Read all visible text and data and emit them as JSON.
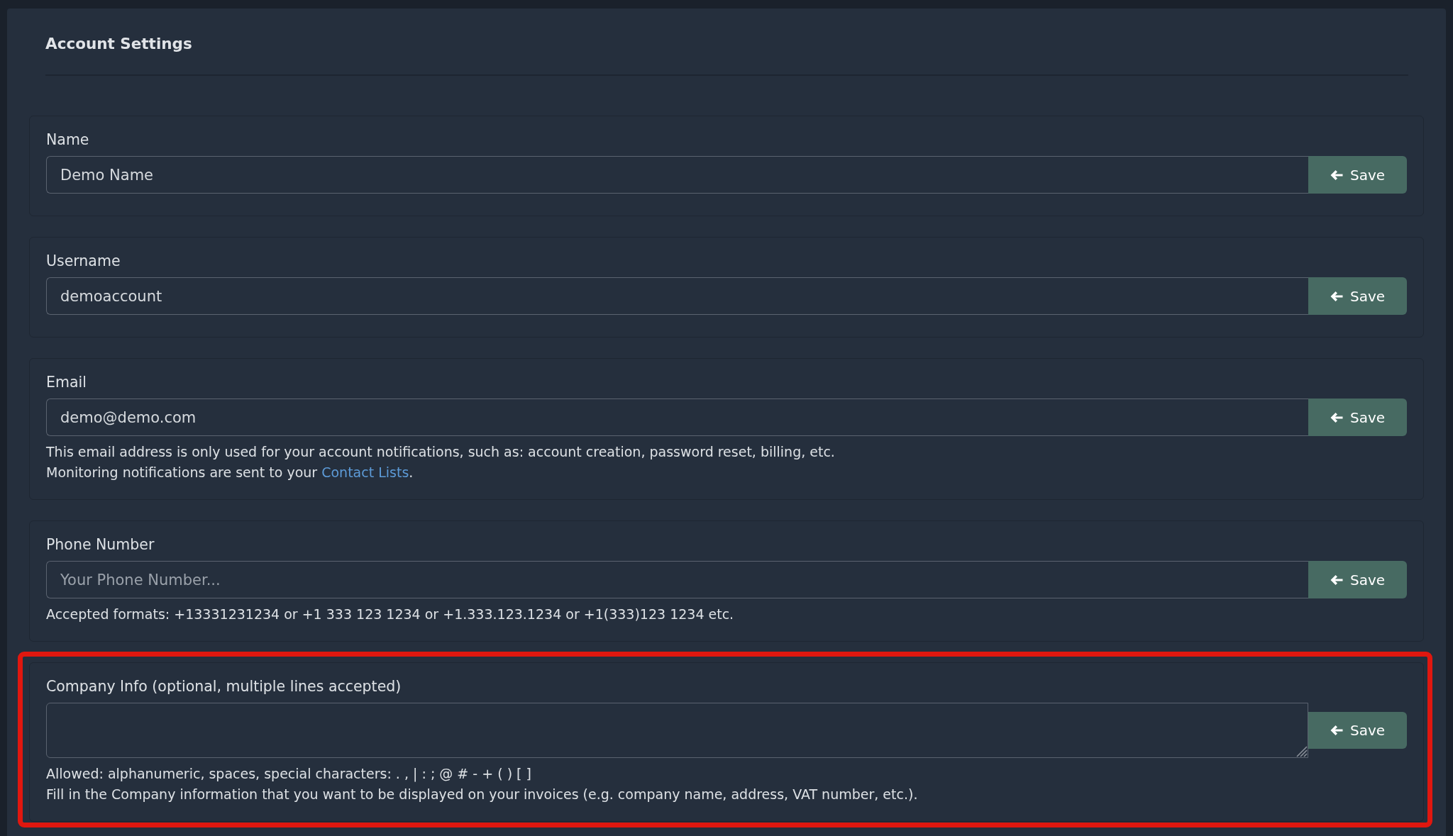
{
  "page": {
    "title": "Account Settings"
  },
  "fields": [
    {
      "kind": "input",
      "label": "Name",
      "value": "Demo Name",
      "button": "Save",
      "highlighted": false
    },
    {
      "kind": "input",
      "label": "Username",
      "value": "demoaccount",
      "button": "Save",
      "highlighted": false
    },
    {
      "kind": "input",
      "label": "Email",
      "value": "demo@demo.com",
      "button": "Save",
      "highlighted": false,
      "help": [
        {
          "text": "This email address is only used for your account notifications, such as: account creation, password reset, billing, etc."
        },
        {
          "text": "Monitoring notifications are sent to your ",
          "link": "Contact Lists",
          "text_after": "."
        }
      ]
    },
    {
      "kind": "input",
      "label": "Phone Number",
      "placeholder": "Your Phone Number...",
      "button": "Save",
      "highlighted": false,
      "help": [
        {
          "text": "Accepted formats: +13331231234 or +1 333 123 1234 or +1.333.123.1234 or +1(333)123 1234 etc."
        }
      ]
    },
    {
      "kind": "textarea",
      "label": "Company Info (optional, multiple lines accepted)",
      "button": "Save",
      "highlighted": true,
      "help": [
        {
          "text": "Allowed: alphanumeric, spaces, special characters: . , | : ; @ # - + ( ) [ ]"
        },
        {
          "text": "Fill in the Company information that you want to be displayed on your invoices (e.g. company name, address, VAT number, etc.)."
        }
      ]
    }
  ]
}
